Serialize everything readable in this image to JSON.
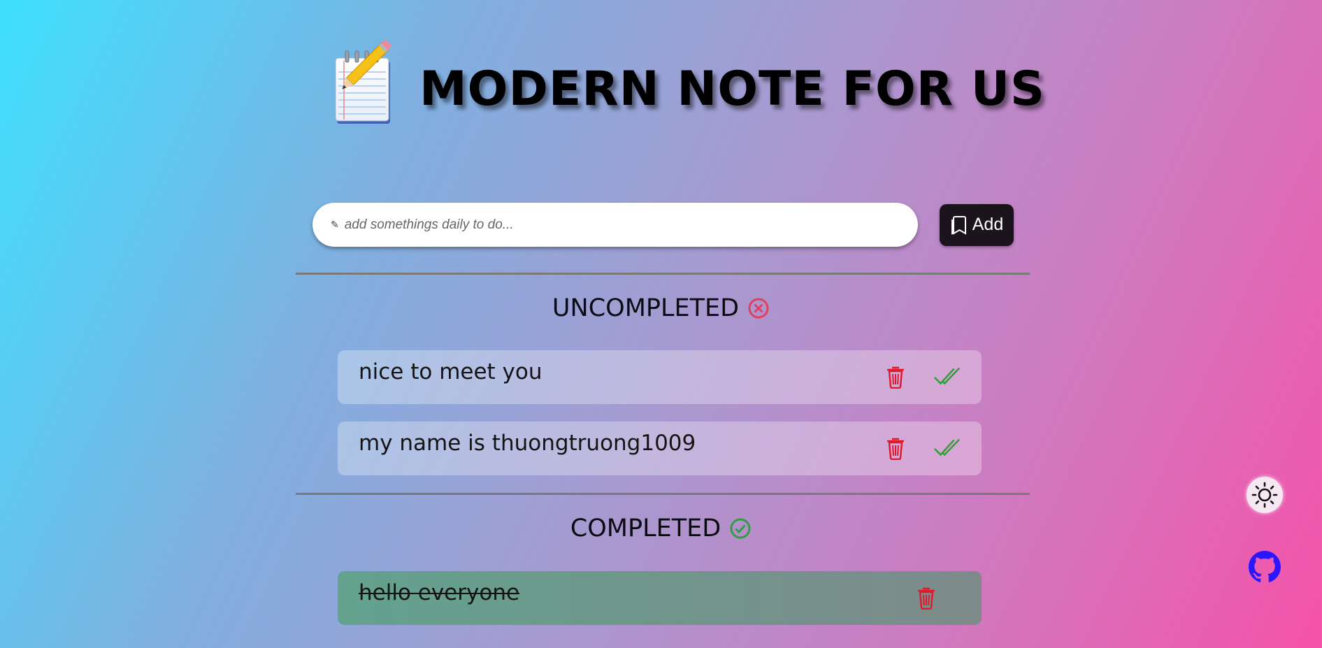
{
  "header": {
    "title": "MODERN NOTE FOR US",
    "icon": "notepad-pencil-icon"
  },
  "input": {
    "placeholder": "add somethings daily to do...",
    "value": "",
    "prefix_icon": "pencil-icon"
  },
  "add_button": {
    "label": "Add",
    "icon": "bookmarks-icon"
  },
  "sections": {
    "uncompleted": {
      "label": "UNCOMPLETED",
      "icon": "x-circle-icon",
      "icon_color": "#e0405f",
      "items": [
        {
          "text": "nice to meet you"
        },
        {
          "text": "my name is thuongtruong1009"
        }
      ]
    },
    "completed": {
      "label": "COMPLETED",
      "icon": "check-circle-icon",
      "icon_color": "#2f9e44",
      "items": [
        {
          "text": "hello everyone"
        }
      ]
    }
  },
  "controls": {
    "theme_toggle_icon": "sun-icon",
    "github_icon": "github-icon"
  },
  "colors": {
    "delete": "#e01a2b",
    "complete": "#2f9e3a",
    "add_button_bg": "#1b141c",
    "github": "#2a16ff"
  }
}
